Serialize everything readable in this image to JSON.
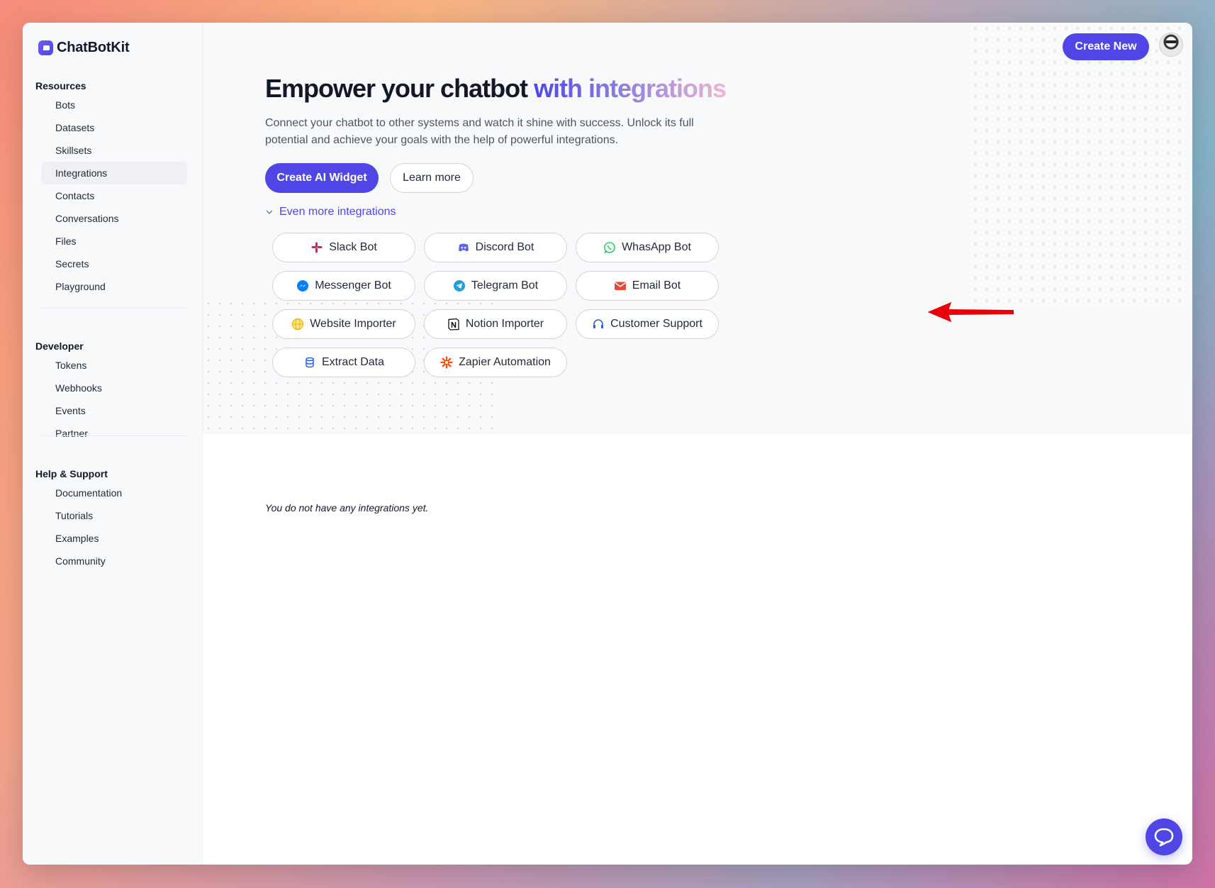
{
  "app": {
    "name": "ChatBotKit"
  },
  "sidebar": {
    "sections": [
      {
        "heading": "Resources",
        "items": [
          "Bots",
          "Datasets",
          "Skillsets",
          "Integrations",
          "Contacts",
          "Conversations",
          "Files",
          "Secrets",
          "Playground"
        ]
      },
      {
        "heading": "Developer",
        "items": [
          "Tokens",
          "Webhooks",
          "Events",
          "Partner"
        ]
      },
      {
        "heading": "Help & Support",
        "items": [
          "Documentation",
          "Tutorials",
          "Examples",
          "Community"
        ]
      }
    ],
    "active_item": "Integrations"
  },
  "header": {
    "create_new_label": "Create New"
  },
  "hero": {
    "title_main": "Empower your chatbot",
    "title_accent": "with integrations",
    "subtitle": "Connect your chatbot to other systems and watch it shine with success. Unlock its full potential and achieve your goals with the help of powerful integrations.",
    "primary_label": "Create AI Widget",
    "secondary_label": "Learn more",
    "more_toggle_label": "Even more integrations"
  },
  "integrations": [
    {
      "label": "Slack Bot",
      "icon": "slack-icon"
    },
    {
      "label": "Discord Bot",
      "icon": "discord-icon"
    },
    {
      "label": "WhasApp Bot",
      "icon": "whatsapp-icon"
    },
    {
      "label": "Messenger Bot",
      "icon": "messenger-icon"
    },
    {
      "label": "Telegram Bot",
      "icon": "telegram-icon"
    },
    {
      "label": "Email Bot",
      "icon": "email-icon"
    },
    {
      "label": "Website Importer",
      "icon": "globe-icon"
    },
    {
      "label": "Notion Importer",
      "icon": "notion-icon"
    },
    {
      "label": "Customer Support",
      "icon": "headset-icon"
    },
    {
      "label": "Extract Data",
      "icon": "database-icon"
    },
    {
      "label": "Zapier Automation",
      "icon": "zapier-icon"
    }
  ],
  "empty_state": {
    "message": "You do not have any integrations yet."
  },
  "colors": {
    "accent": "#4f46e5",
    "annotation_arrow": "#e8000b"
  }
}
